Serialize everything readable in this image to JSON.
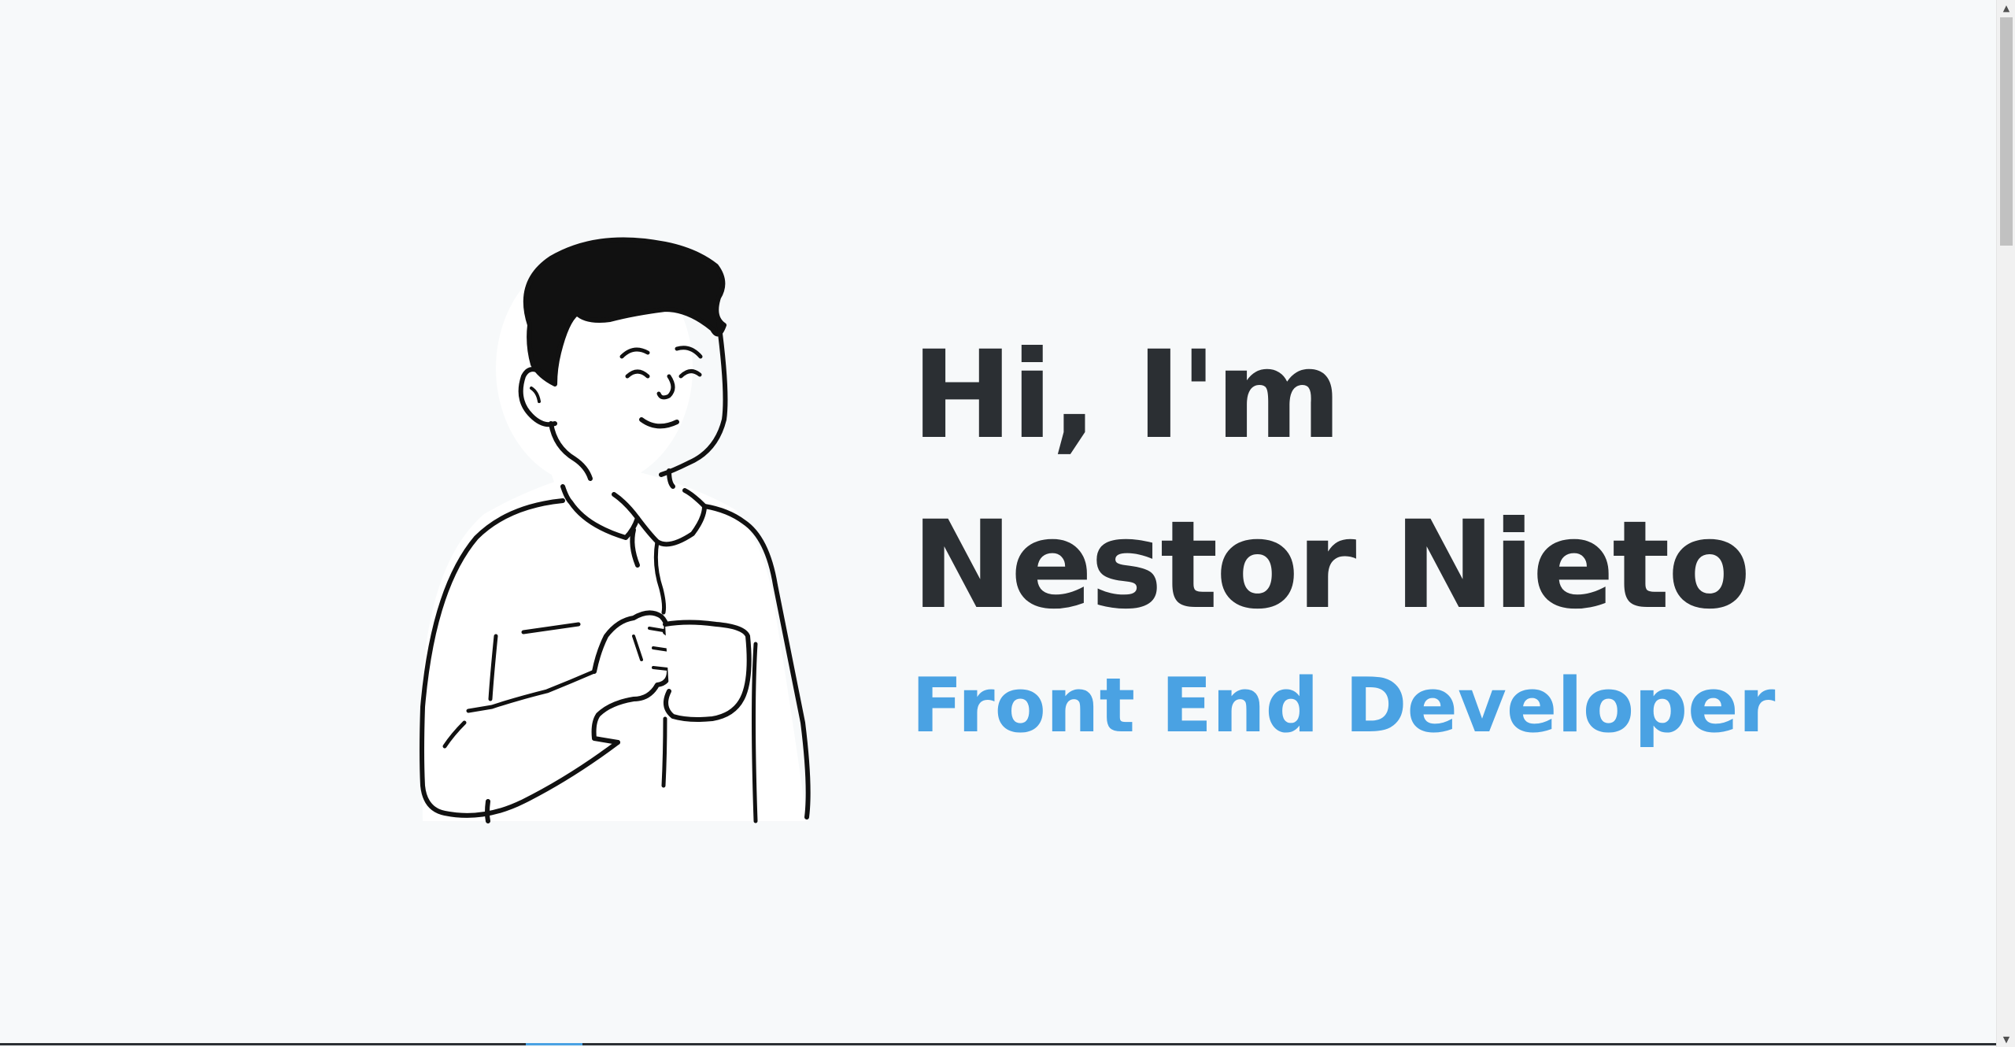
{
  "hero": {
    "greeting": "Hi, I'm",
    "name": "Nestor Nieto",
    "role": "Front End Developer"
  },
  "illustration": {
    "icon": "person-holding-mug-illustration"
  },
  "colors": {
    "background": "#f7f9fa",
    "heading": "#2b2f33",
    "accent": "#4aa2e3"
  },
  "scrollbar": {
    "up_arrow": "▲",
    "down_arrow": "▼"
  }
}
